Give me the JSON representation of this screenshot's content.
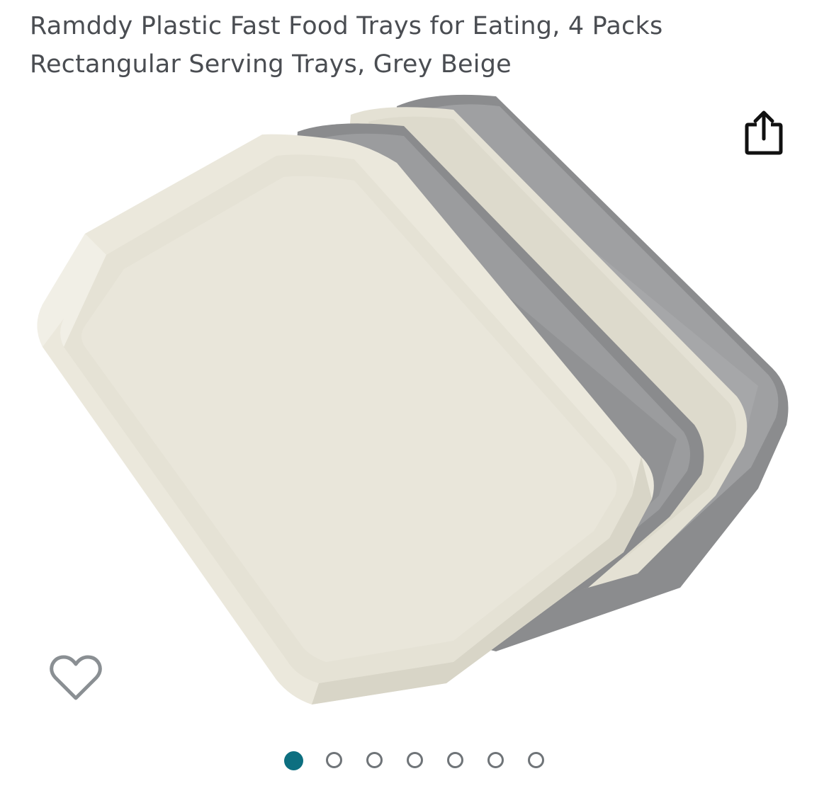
{
  "product": {
    "title_line1": "Ramddy Plastic Fast Food Trays for Eating, 4 Packs",
    "title_line2": "Rectangular Serving Trays, Grey Beige"
  },
  "actions": {
    "share_icon": "share-icon",
    "wishlist_icon": "heart-outline-icon"
  },
  "gallery": {
    "image_count": 7,
    "active_index": 0,
    "active_color": "#0d6f80",
    "inactive_color": "#6f7478"
  },
  "colors": {
    "title": "#4a4d52",
    "tray_beige": "#e9e6da",
    "tray_grey": "#8d8e90"
  }
}
